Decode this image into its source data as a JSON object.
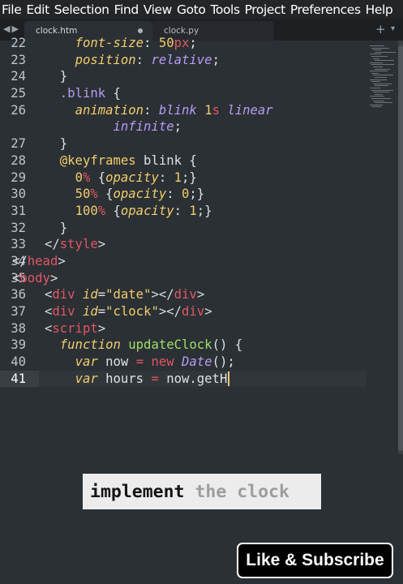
{
  "menu": [
    "File",
    "Edit",
    "Selection",
    "Find",
    "View",
    "Goto",
    "Tools",
    "Project",
    "Preferences",
    "Help"
  ],
  "tabs": [
    {
      "label": "clock.htm",
      "active": true,
      "dirty": true
    },
    {
      "label": "clock.py",
      "active": false,
      "dirty": false
    }
  ],
  "editor": {
    "current_line": "41",
    "lines": [
      {
        "n": "22",
        "text": "font-size: 50px;"
      },
      {
        "n": "23",
        "text": "position: relative;"
      },
      {
        "n": "24",
        "text": "}"
      },
      {
        "n": "25",
        "text": ".blink {"
      },
      {
        "n": "26",
        "text": "animation: blink 1s linear infinite;"
      },
      {
        "n": "27",
        "text": "}"
      },
      {
        "n": "28",
        "text": "@keyframes blink {"
      },
      {
        "n": "29",
        "text": "0% {opacity: 1;}"
      },
      {
        "n": "30",
        "text": "50% {opacity: 0;}"
      },
      {
        "n": "31",
        "text": "100% {opacity: 1;}"
      },
      {
        "n": "32",
        "text": "}"
      },
      {
        "n": "33",
        "text": "</style>"
      },
      {
        "n": "34",
        "text": "</head>"
      },
      {
        "n": "35",
        "text": "<body>"
      },
      {
        "n": "36",
        "text": "<div id=\"date\"></div>"
      },
      {
        "n": "37",
        "text": "<div id=\"clock\"></div>"
      },
      {
        "n": "38",
        "text": "<script>"
      },
      {
        "n": "39",
        "text": "function updateClock() {"
      },
      {
        "n": "40",
        "text": "var now = new Date();"
      },
      {
        "n": "41",
        "text": "var hours = now.getH"
      }
    ]
  },
  "caption": {
    "typed": "implement",
    "pending": " the clock"
  },
  "badge": {
    "label": "Like & Subscribe"
  },
  "colors": {
    "background": "#2b3035",
    "tag": "#e05663",
    "keyword": "#f1cd6c",
    "function": "#9fe06b",
    "value": "#b59df2"
  }
}
